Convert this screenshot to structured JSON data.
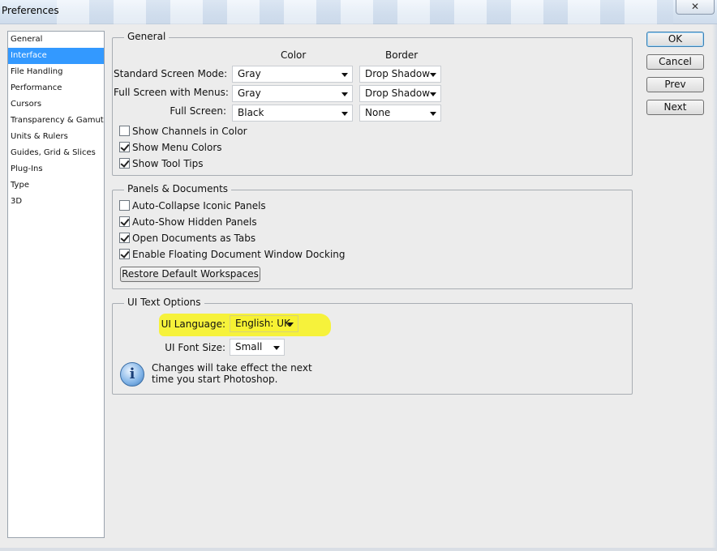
{
  "window": {
    "title": "Preferences",
    "close_glyph": "✕"
  },
  "sidebar": {
    "items": [
      {
        "label": "General"
      },
      {
        "label": "Interface"
      },
      {
        "label": "File Handling"
      },
      {
        "label": "Performance"
      },
      {
        "label": "Cursors"
      },
      {
        "label": "Transparency & Gamut"
      },
      {
        "label": "Units & Rulers"
      },
      {
        "label": "Guides, Grid & Slices"
      },
      {
        "label": "Plug-Ins"
      },
      {
        "label": "Type"
      },
      {
        "label": "3D"
      }
    ],
    "selected": "Interface"
  },
  "general": {
    "legend": "General",
    "color_header": "Color",
    "border_header": "Border",
    "standard_label": "Standard Screen Mode:",
    "standard_color": "Gray",
    "standard_border": "Drop Shadow",
    "fullmenus_label": "Full Screen with Menus:",
    "fullmenus_color": "Gray",
    "fullmenus_border": "Drop Shadow",
    "full_label": "Full Screen:",
    "full_color": "Black",
    "full_border": "None",
    "channels_label": "Show Channels in Color",
    "channels_checked": false,
    "menucolors_label": "Show Menu Colors",
    "menucolors_checked": true,
    "tooltips_label": "Show Tool Tips",
    "tooltips_checked": true
  },
  "panels": {
    "legend": "Panels & Documents",
    "autocollapse_label": "Auto-Collapse Iconic Panels",
    "autocollapse_checked": false,
    "autoshow_label": "Auto-Show Hidden Panels",
    "autoshow_checked": true,
    "tabs_label": "Open Documents as Tabs",
    "tabs_checked": true,
    "docking_label": "Enable Floating Document Window Docking",
    "docking_checked": true,
    "restore_label": "Restore Default Workspaces"
  },
  "uitext": {
    "legend": "UI Text Options",
    "language_label": "UI Language:",
    "language_value": "English: UK",
    "fontsize_label": "UI Font Size:",
    "fontsize_value": "Small",
    "info_line1": "Changes will take effect the next",
    "info_line2": "time you start Photoshop.",
    "info_icon_glyph": "i",
    "highlight_color": "#f7f232"
  },
  "buttons": {
    "ok": "OK",
    "cancel": "Cancel",
    "prev": "Prev",
    "next": "Next"
  }
}
